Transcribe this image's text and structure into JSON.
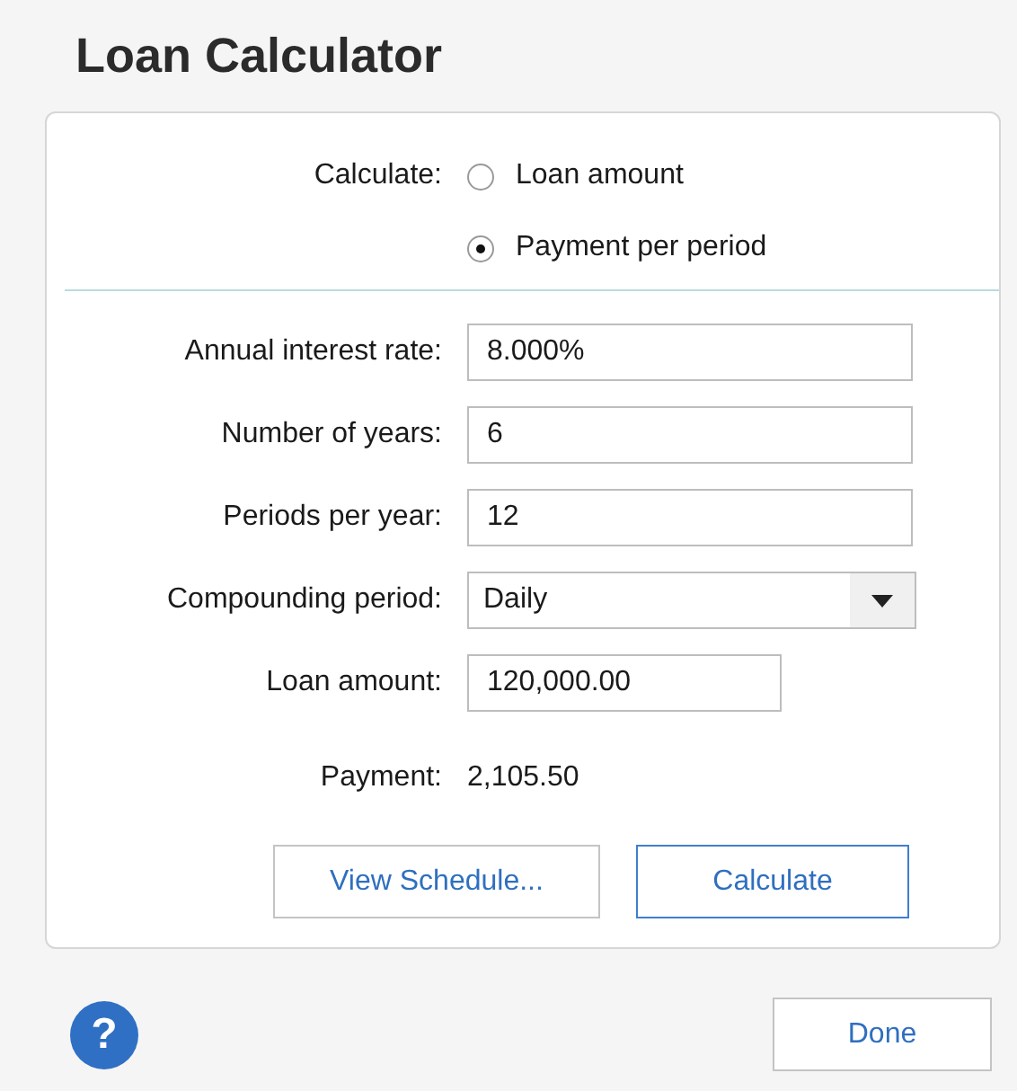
{
  "title": "Loan Calculator",
  "calculate": {
    "label": "Calculate:",
    "options": [
      {
        "label": "Loan amount",
        "selected": false
      },
      {
        "label": "Payment per period",
        "selected": true
      }
    ]
  },
  "fields": [
    {
      "kind": "text",
      "label": "Annual interest rate:",
      "value": "8.000%"
    },
    {
      "kind": "text",
      "label": "Number of years:",
      "value": "6"
    },
    {
      "kind": "text",
      "label": "Periods per year:",
      "value": "12"
    },
    {
      "kind": "dropdown",
      "label": "Compounding period:",
      "value": "Daily"
    },
    {
      "kind": "short-text",
      "label": "Loan amount:",
      "value": "120,000.00"
    }
  ],
  "result": {
    "label": "Payment:",
    "value": "2,105.50"
  },
  "buttons": [
    {
      "label": "View Schedule...",
      "default": false
    },
    {
      "label": "Calculate",
      "default": true
    }
  ],
  "help": {
    "label": "?"
  },
  "done": {
    "label": "Done"
  }
}
